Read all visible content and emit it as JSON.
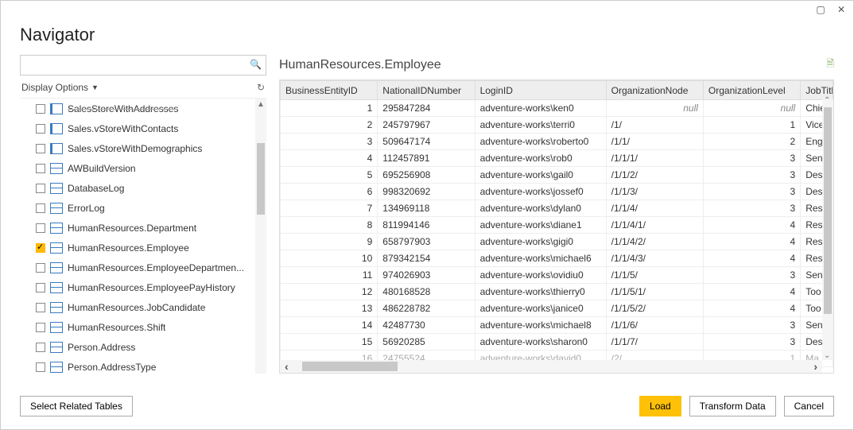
{
  "window": {
    "title": "Navigator"
  },
  "search": {
    "placeholder": ""
  },
  "display_options_label": "Display Options",
  "tree": {
    "items": [
      {
        "label": "SalesStoreWithAddresses",
        "icon": "view",
        "checked": false,
        "partial": true
      },
      {
        "label": "Sales.vStoreWithContacts",
        "icon": "view",
        "checked": false
      },
      {
        "label": "Sales.vStoreWithDemographics",
        "icon": "view",
        "checked": false
      },
      {
        "label": "AWBuildVersion",
        "icon": "table",
        "checked": false
      },
      {
        "label": "DatabaseLog",
        "icon": "table",
        "checked": false
      },
      {
        "label": "ErrorLog",
        "icon": "table",
        "checked": false
      },
      {
        "label": "HumanResources.Department",
        "icon": "table",
        "checked": false
      },
      {
        "label": "HumanResources.Employee",
        "icon": "table",
        "checked": true
      },
      {
        "label": "HumanResources.EmployeeDepartmen...",
        "icon": "table",
        "checked": false
      },
      {
        "label": "HumanResources.EmployeePayHistory",
        "icon": "table",
        "checked": false
      },
      {
        "label": "HumanResources.JobCandidate",
        "icon": "table",
        "checked": false
      },
      {
        "label": "HumanResources.Shift",
        "icon": "table",
        "checked": false
      },
      {
        "label": "Person.Address",
        "icon": "table",
        "checked": false
      },
      {
        "label": "Person.AddressType",
        "icon": "table",
        "checked": false
      }
    ]
  },
  "preview": {
    "title": "HumanResources.Employee",
    "columns": [
      "BusinessEntityID",
      "NationalIDNumber",
      "LoginID",
      "OrganizationNode",
      "OrganizationLevel",
      "JobTitle"
    ],
    "rows": [
      {
        "id": "1",
        "nid": "295847284",
        "login": "adventure-works\\ken0",
        "org": null,
        "lvl": null,
        "job": "Chie"
      },
      {
        "id": "2",
        "nid": "245797967",
        "login": "adventure-works\\terri0",
        "org": "/1/",
        "lvl": "1",
        "job": "Vice"
      },
      {
        "id": "3",
        "nid": "509647174",
        "login": "adventure-works\\roberto0",
        "org": "/1/1/",
        "lvl": "2",
        "job": "Eng"
      },
      {
        "id": "4",
        "nid": "112457891",
        "login": "adventure-works\\rob0",
        "org": "/1/1/1/",
        "lvl": "3",
        "job": "Sen"
      },
      {
        "id": "5",
        "nid": "695256908",
        "login": "adventure-works\\gail0",
        "org": "/1/1/2/",
        "lvl": "3",
        "job": "Des"
      },
      {
        "id": "6",
        "nid": "998320692",
        "login": "adventure-works\\jossef0",
        "org": "/1/1/3/",
        "lvl": "3",
        "job": "Des"
      },
      {
        "id": "7",
        "nid": "134969118",
        "login": "adventure-works\\dylan0",
        "org": "/1/1/4/",
        "lvl": "3",
        "job": "Res"
      },
      {
        "id": "8",
        "nid": "811994146",
        "login": "adventure-works\\diane1",
        "org": "/1/1/4/1/",
        "lvl": "4",
        "job": "Res"
      },
      {
        "id": "9",
        "nid": "658797903",
        "login": "adventure-works\\gigi0",
        "org": "/1/1/4/2/",
        "lvl": "4",
        "job": "Res"
      },
      {
        "id": "10",
        "nid": "879342154",
        "login": "adventure-works\\michael6",
        "org": "/1/1/4/3/",
        "lvl": "4",
        "job": "Res"
      },
      {
        "id": "11",
        "nid": "974026903",
        "login": "adventure-works\\ovidiu0",
        "org": "/1/1/5/",
        "lvl": "3",
        "job": "Sen"
      },
      {
        "id": "12",
        "nid": "480168528",
        "login": "adventure-works\\thierry0",
        "org": "/1/1/5/1/",
        "lvl": "4",
        "job": "Too"
      },
      {
        "id": "13",
        "nid": "486228782",
        "login": "adventure-works\\janice0",
        "org": "/1/1/5/2/",
        "lvl": "4",
        "job": "Too"
      },
      {
        "id": "14",
        "nid": "42487730",
        "login": "adventure-works\\michael8",
        "org": "/1/1/6/",
        "lvl": "3",
        "job": "Sen"
      },
      {
        "id": "15",
        "nid": "56920285",
        "login": "adventure-works\\sharon0",
        "org": "/1/1/7/",
        "lvl": "3",
        "job": "Des"
      },
      {
        "id": "16",
        "nid": "24755524",
        "login": "adventure-works\\david0",
        "org": "/2/",
        "lvl": "1",
        "job": "Ma",
        "cut": true
      }
    ]
  },
  "footer": {
    "select_related": "Select Related Tables",
    "load": "Load",
    "transform": "Transform Data",
    "cancel": "Cancel"
  }
}
